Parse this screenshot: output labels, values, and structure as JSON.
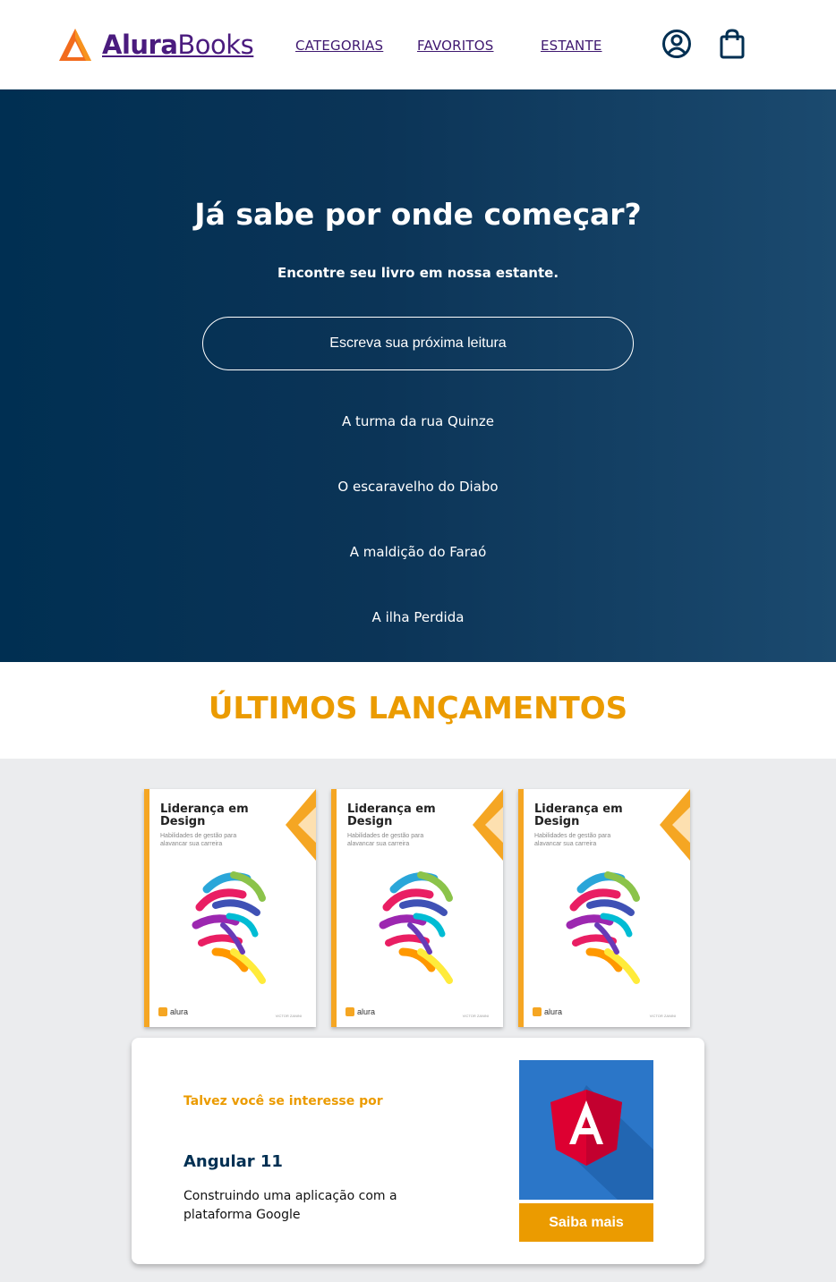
{
  "header": {
    "logo_bold": "Alura",
    "logo_regular": "Books",
    "nav": [
      "CATEGORIAS",
      "FAVORITOS",
      "ESTANTE"
    ],
    "icons": [
      "user-circle-icon",
      "shopping-bag-icon"
    ]
  },
  "hero": {
    "title": "Já sabe por onde começar?",
    "subtitle": "Encontre seu livro em nossa estante.",
    "search_placeholder": "Escreva sua próxima leitura",
    "suggestions": [
      "A turma da rua Quinze",
      "O escaravelho do Diabo",
      "A maldição do Faraó",
      "A ilha Perdida"
    ]
  },
  "releases": {
    "title": "ÚLTIMOS LANÇAMENTOS",
    "books": [
      {
        "title": "Liderança em Design",
        "subtitle": "Habilidades de gestão para alavancar sua carreira",
        "publisher": "alura",
        "author": "VICTOR ZANINI"
      },
      {
        "title": "Liderança em Design",
        "subtitle": "Habilidades de gestão para alavancar sua carreira",
        "publisher": "alura",
        "author": "VICTOR ZANINI"
      },
      {
        "title": "Liderança em Design",
        "subtitle": "Habilidades de gestão para alavancar sua carreira",
        "publisher": "alura",
        "author": "VICTOR ZANINI"
      }
    ]
  },
  "recommendation": {
    "label": "Talvez você se interesse por",
    "title": "Angular 11",
    "description": "Construindo uma aplicação com a plataforma Google",
    "button": "Saiba mais"
  },
  "colors": {
    "brand_orange": "#eb9b00",
    "hero_dark": "#002f52",
    "brand_purple": "#4a1b7e",
    "angular_blue": "#2b76c8",
    "angular_red": "#dd0031"
  }
}
